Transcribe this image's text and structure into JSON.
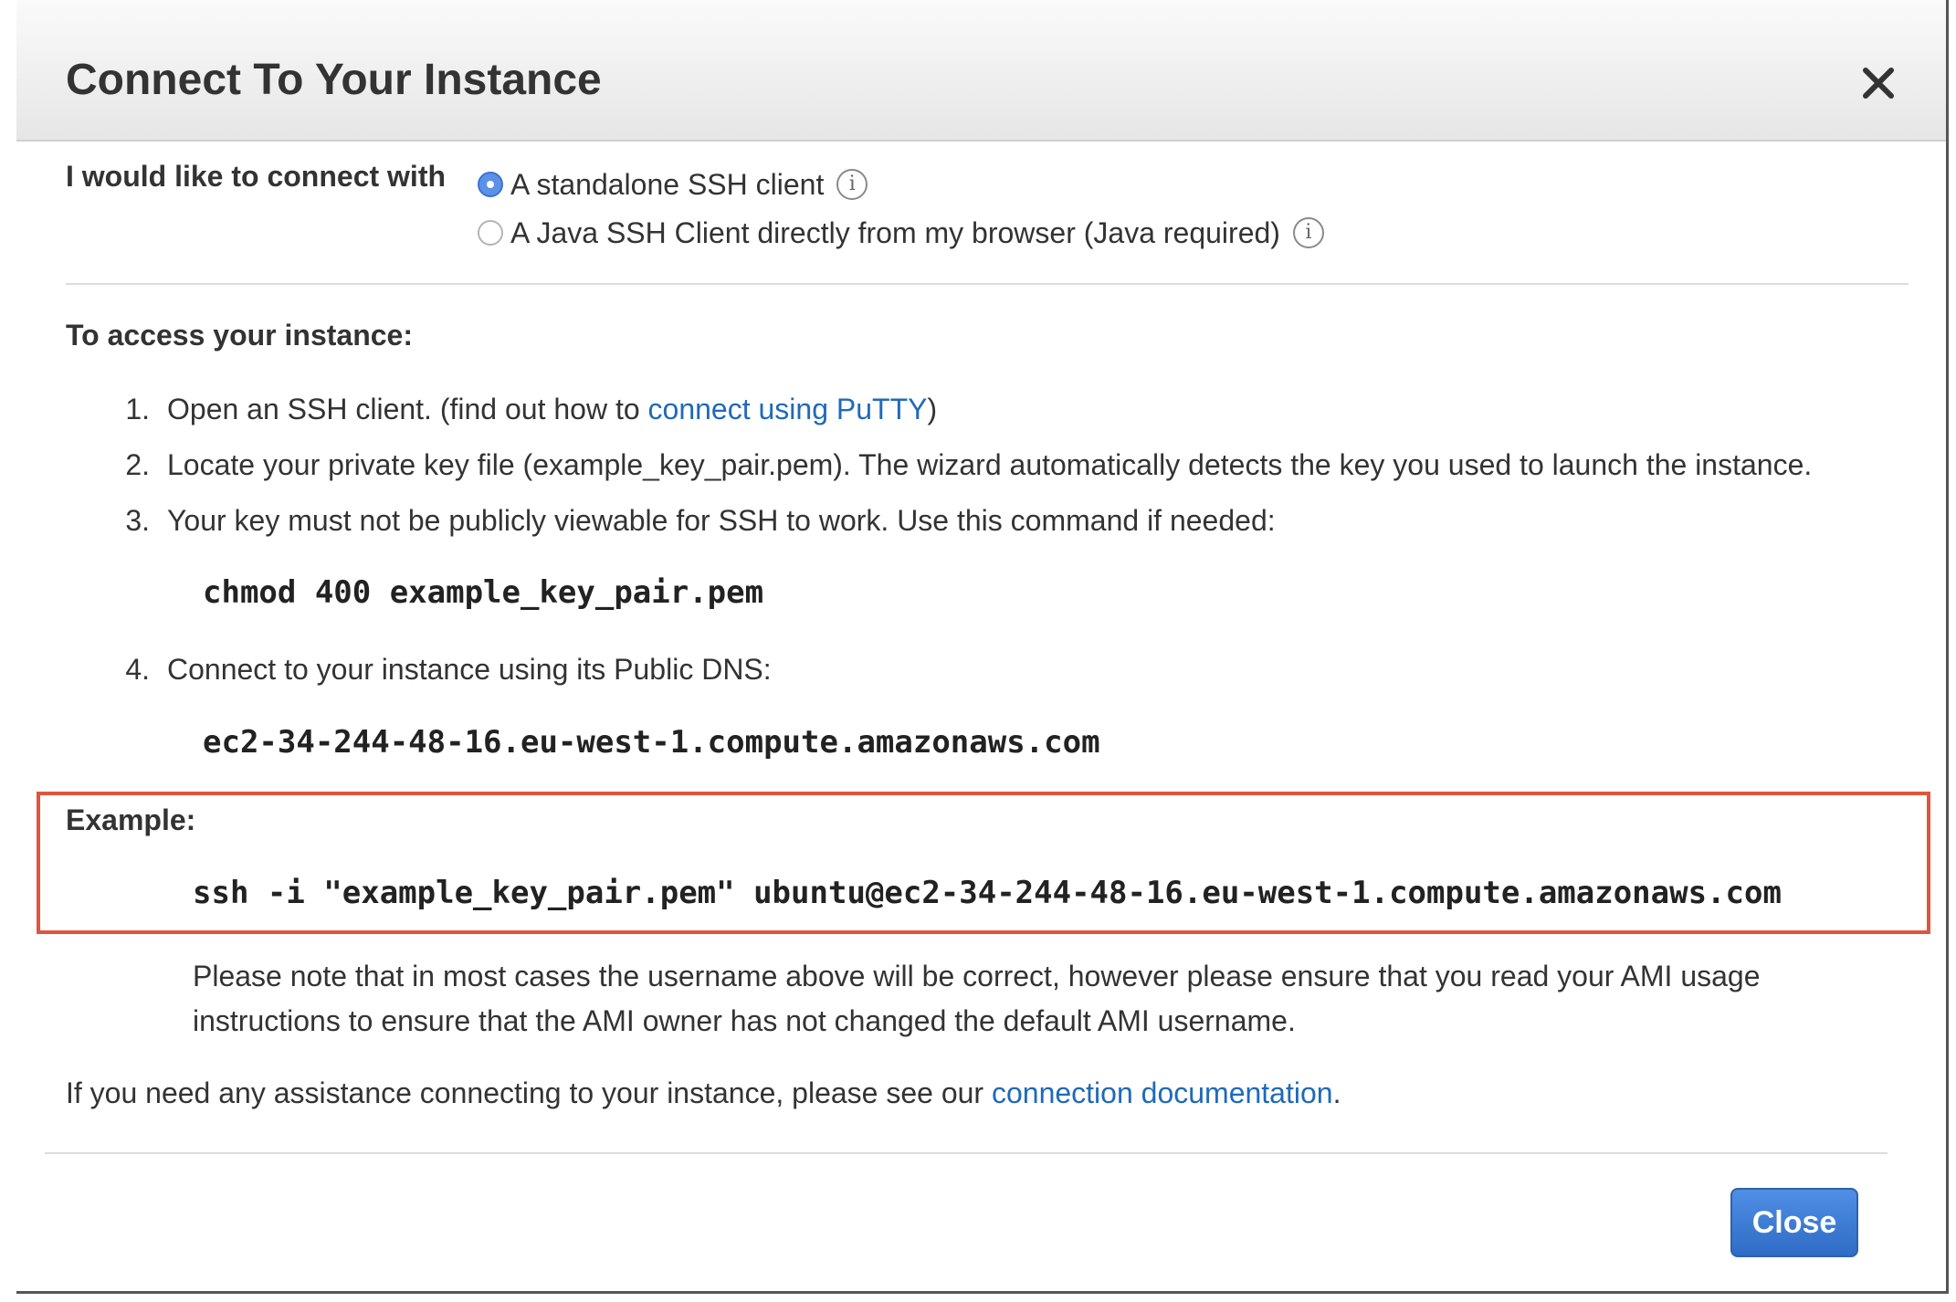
{
  "dialog": {
    "title": "Connect To Your Instance",
    "close_icon": "close-icon"
  },
  "connect_with": {
    "label": "I would like to connect with",
    "options": [
      {
        "label": "A standalone SSH client",
        "selected": true
      },
      {
        "label": "A Java SSH Client directly from my browser (Java required)",
        "selected": false
      }
    ],
    "info_icon": "info-icon",
    "info_glyph": "i"
  },
  "access": {
    "title": "To access your instance:",
    "steps": [
      {
        "num": "1.",
        "text_before": "Open an SSH client. (find out how to ",
        "link": "connect using PuTTY",
        "text_after": ")"
      },
      {
        "num": "2.",
        "text": "Locate your private key file (example_key_pair.pem). The wizard automatically detects the key you used to launch the instance."
      },
      {
        "num": "3.",
        "text": "Your key must not be publicly viewable for SSH to work. Use this command if needed:"
      },
      {
        "num": "4.",
        "text": "Connect to your instance using its Public DNS:"
      }
    ],
    "chmod_command": "chmod 400 example_key_pair.pem",
    "public_dns": "ec2-34-244-48-16.eu-west-1.compute.amazonaws.com"
  },
  "example": {
    "label": "Example:",
    "command": "ssh -i \"example_key_pair.pem\" ubuntu@ec2-34-244-48-16.eu-west-1.compute.amazonaws.com",
    "highlight_color": "#e0553f"
  },
  "note": "Please note that in most cases the username above will be correct, however please ensure that you read your AMI usage instructions to ensure that the AMI owner has not changed the default AMI username.",
  "assistance": {
    "text_before": "If you need any assistance connecting to your instance, please see our ",
    "link": "connection documentation",
    "text_after": "."
  },
  "footer": {
    "close_label": "Close"
  },
  "colors": {
    "link": "#1f6ab9",
    "primary_button": "#3a79d6",
    "radio_selected": "#5b91e6"
  }
}
